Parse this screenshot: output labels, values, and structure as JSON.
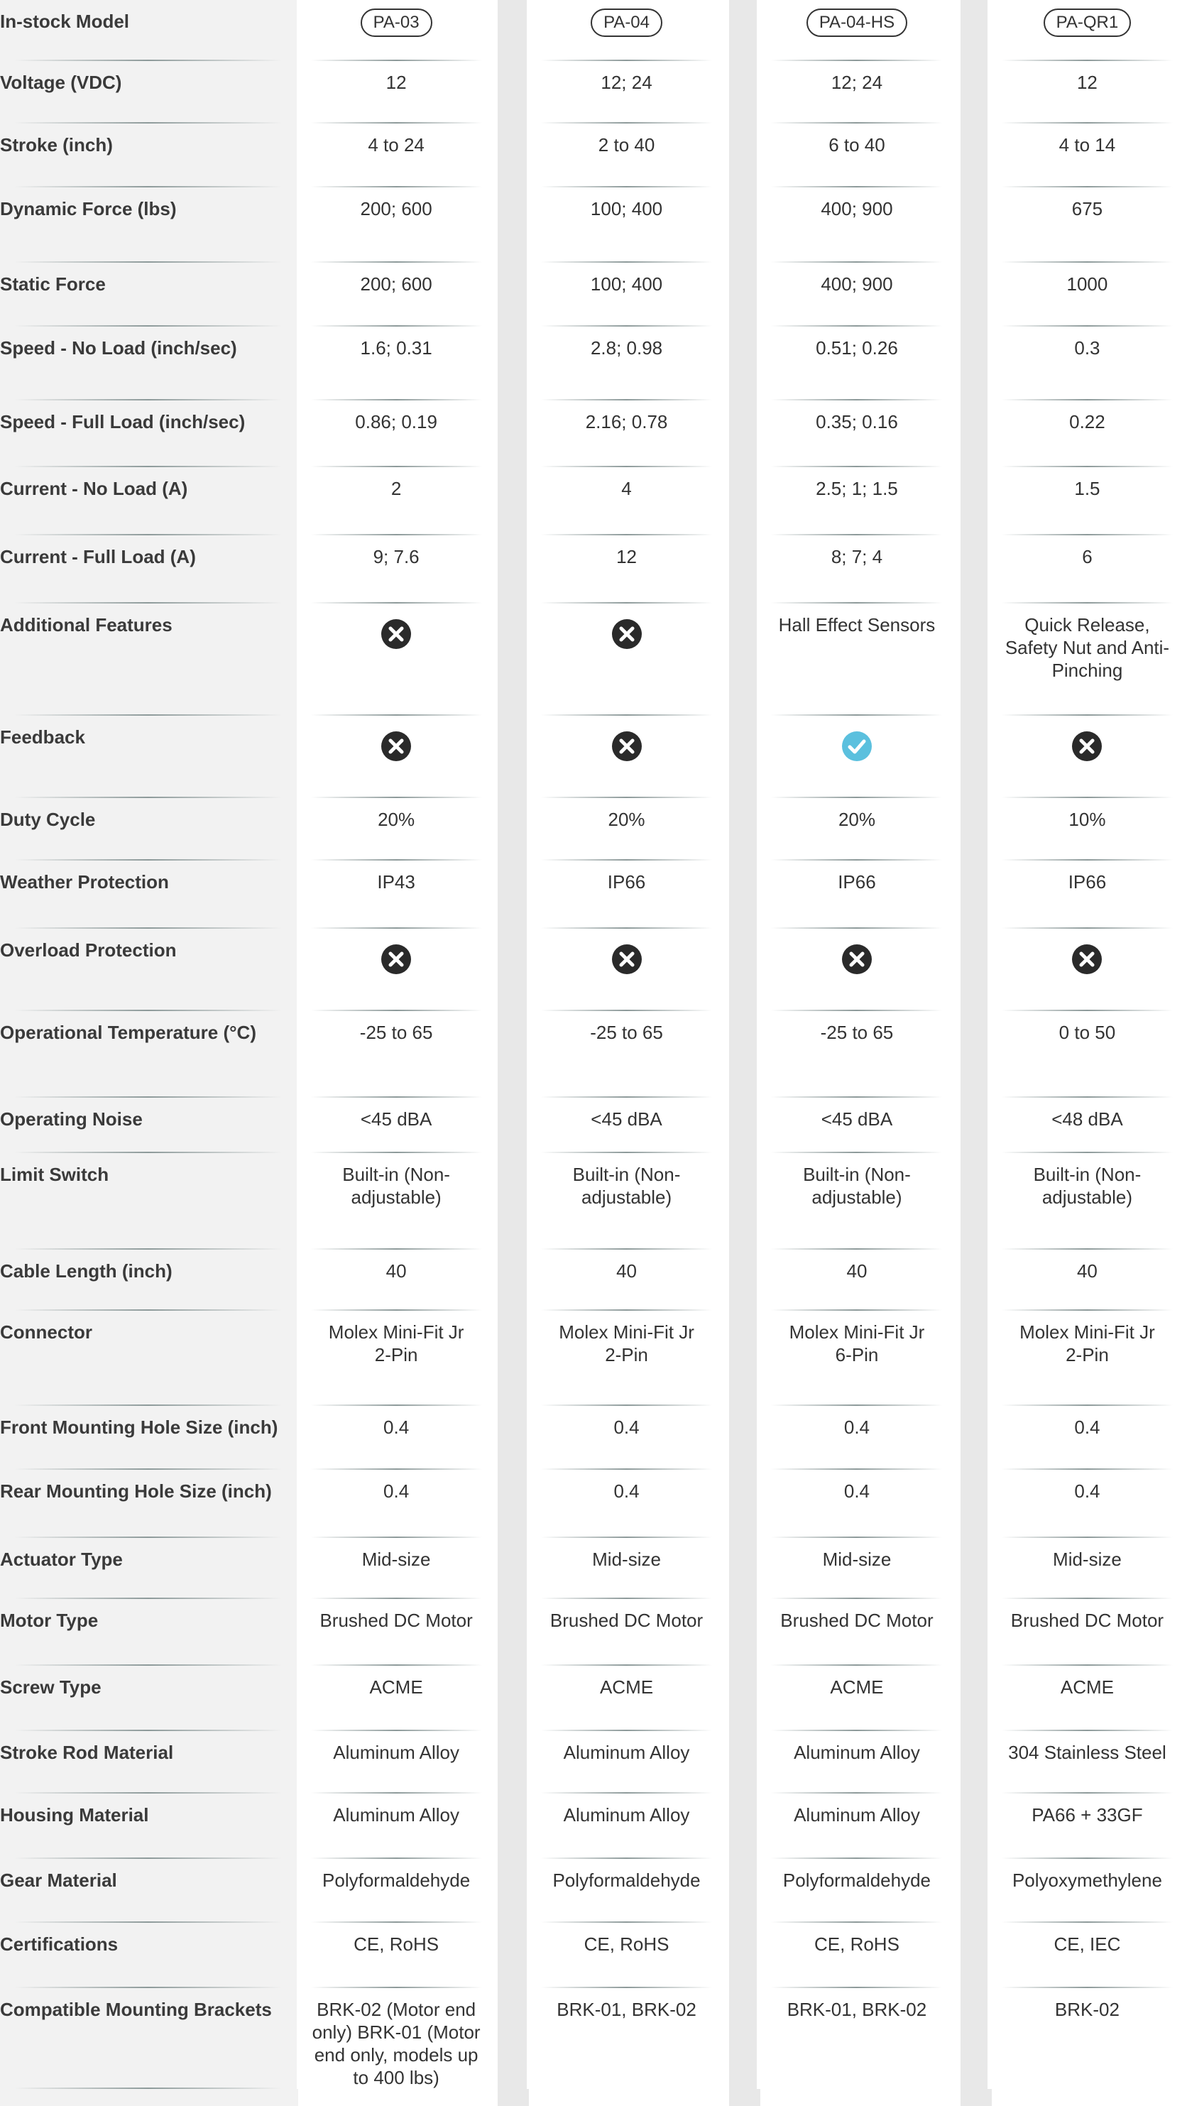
{
  "models": [
    "PA-03",
    "PA-04",
    "PA-04-HS",
    "PA-QR1"
  ],
  "header_label": "In-stock Model",
  "rows": [
    {
      "label": "Voltage (VDC)",
      "values": [
        "12",
        "12; 24",
        "12; 24",
        "12"
      ]
    },
    {
      "label": "Stroke (inch)",
      "values": [
        "4 to 24",
        "2 to 40",
        "6 to 40",
        "4 to 14"
      ]
    },
    {
      "label": "Dynamic Force (lbs)",
      "values": [
        "200; 600",
        "100; 400",
        "400; 900",
        "675"
      ]
    },
    {
      "label": "Static Force",
      "values": [
        "200; 600",
        "100; 400",
        "400; 900",
        "1000"
      ]
    },
    {
      "label": "Speed - No Load (inch/sec)",
      "values": [
        "1.6; 0.31",
        "2.8; 0.98",
        "0.51; 0.26",
        "0.3"
      ]
    },
    {
      "label": "Speed - Full Load (inch/sec)",
      "values": [
        "0.86; 0.19",
        "2.16; 0.78",
        "0.35; 0.16",
        "0.22"
      ]
    },
    {
      "label": "Current - No Load (A)",
      "values": [
        "2",
        "4",
        "2.5; 1; 1.5",
        "1.5"
      ]
    },
    {
      "label": "Current - Full Load (A)",
      "values": [
        "9; 7.6",
        "12",
        "8; 7; 4",
        "6"
      ]
    },
    {
      "label": "Additional Features",
      "values": [
        "x-icon",
        "x-icon",
        "Hall Effect Sensors",
        "Quick Release, Safety Nut and Anti-Pinching"
      ]
    },
    {
      "label": "Feedback",
      "values": [
        "x-icon",
        "x-icon",
        "check-icon",
        "x-icon"
      ]
    },
    {
      "label": "Duty Cycle",
      "values": [
        "20%",
        "20%",
        "20%",
        "10%"
      ]
    },
    {
      "label": "Weather Protection",
      "values": [
        "IP43",
        "IP66",
        "IP66",
        "IP66"
      ]
    },
    {
      "label": "Overload Protection",
      "values": [
        "x-icon",
        "x-icon",
        "x-icon",
        "x-icon"
      ]
    },
    {
      "label": "Operational Temperature (°C)",
      "values": [
        "-25 to 65",
        "-25 to 65",
        "-25 to 65",
        "0 to 50"
      ]
    },
    {
      "label": "Operating Noise",
      "values": [
        "<45 dBA",
        "<45 dBA",
        "<45 dBA",
        "<48 dBA"
      ]
    },
    {
      "label": "Limit Switch",
      "values": [
        "Built-in (Non-adjustable)",
        "Built-in (Non-adjustable)",
        "Built-in (Non-adjustable)",
        "Built-in (Non-adjustable)"
      ]
    },
    {
      "label": "Cable Length (inch)",
      "values": [
        "40",
        "40",
        "40",
        "40"
      ]
    },
    {
      "label": "Connector",
      "values": [
        "Molex Mini-Fit Jr 2-Pin",
        "Molex Mini-Fit Jr 2-Pin",
        "Molex Mini-Fit Jr 6-Pin",
        "Molex Mini-Fit Jr 2-Pin"
      ]
    },
    {
      "label": "Front Mounting Hole Size (inch)",
      "values": [
        "0.4",
        "0.4",
        "0.4",
        "0.4"
      ]
    },
    {
      "label": "Rear Mounting Hole Size (inch)",
      "values": [
        "0.4",
        "0.4",
        "0.4",
        "0.4"
      ]
    },
    {
      "label": "Actuator Type",
      "values": [
        "Mid-size",
        "Mid-size",
        "Mid-size",
        "Mid-size"
      ]
    },
    {
      "label": "Motor Type",
      "values": [
        "Brushed DC Motor",
        "Brushed DC Motor",
        "Brushed DC Motor",
        "Brushed DC Motor"
      ]
    },
    {
      "label": "Screw Type",
      "values": [
        "ACME",
        "ACME",
        "ACME",
        "ACME"
      ]
    },
    {
      "label": "Stroke Rod Material",
      "values": [
        "Aluminum Alloy",
        "Aluminum Alloy",
        "Aluminum Alloy",
        "304 Stainless Steel"
      ]
    },
    {
      "label": "Housing Material",
      "values": [
        "Aluminum Alloy",
        "Aluminum Alloy",
        "Aluminum Alloy",
        "PA66 + 33GF"
      ]
    },
    {
      "label": "Gear Material",
      "values": [
        "Polyformaldehyde",
        "Polyformaldehyde",
        "Polyformaldehyde",
        "Polyoxymethylene"
      ]
    },
    {
      "label": "Certifications",
      "values": [
        "CE, RoHS",
        "CE, RoHS",
        "CE, RoHS",
        "CE, IEC"
      ]
    },
    {
      "label": "Compatible Mounting Brackets",
      "values": [
        "BRK-02 (Motor end only) BRK-01 (Motor end only, models up to 400 lbs)",
        "BRK-01, BRK-02",
        "BRK-01, BRK-02",
        "BRK-02"
      ]
    }
  ],
  "colors": {
    "check": "#5bc0de",
    "x": "#2a2a2a",
    "label_bg": "#f2f2f2",
    "gap_bg": "#e8e8e8"
  }
}
